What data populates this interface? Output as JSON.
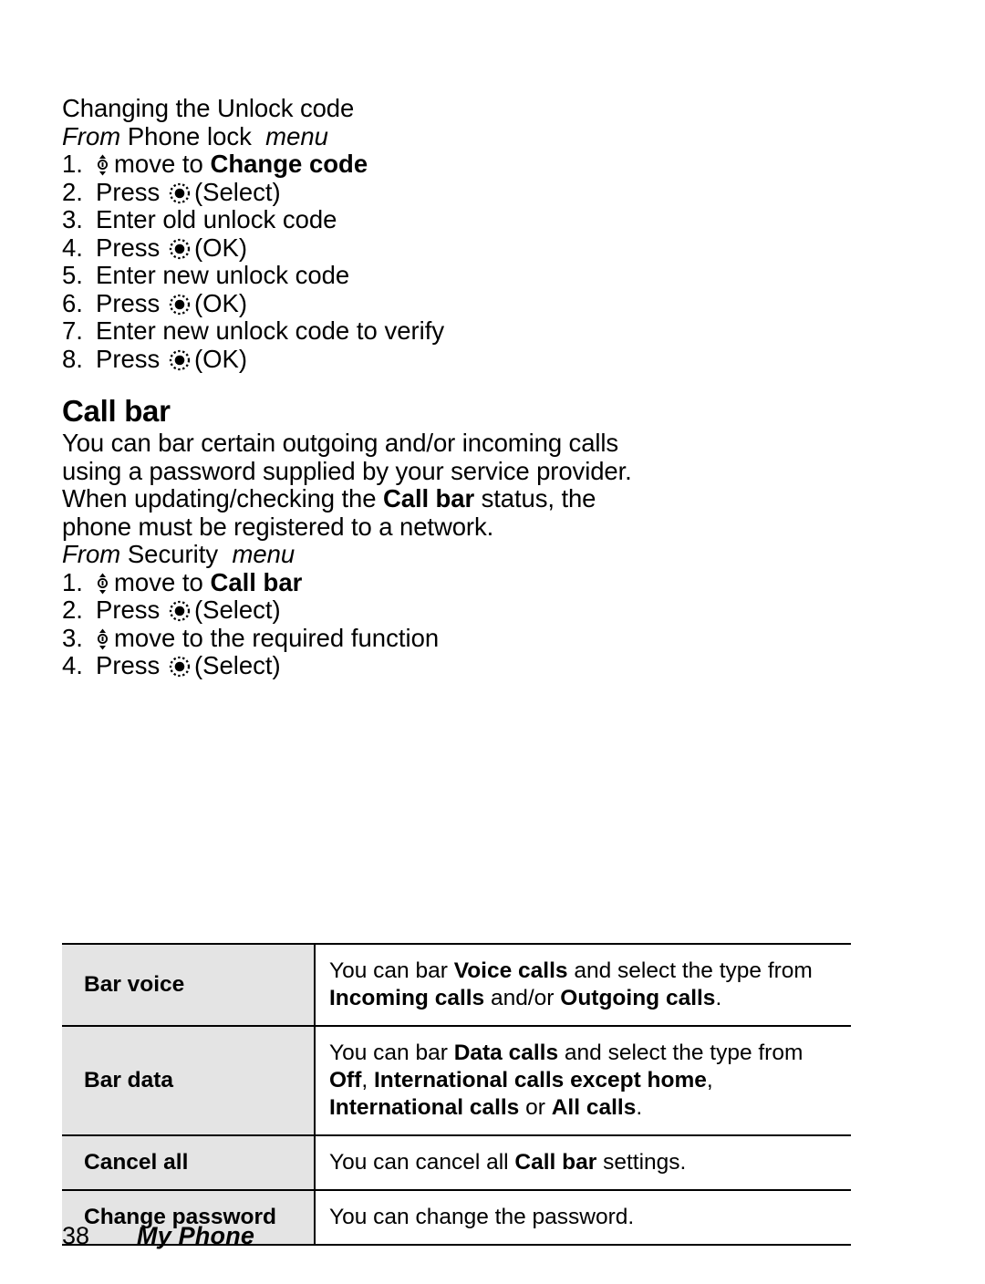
{
  "page": {
    "number": "38",
    "book_title": "My Phone"
  },
  "icons": {
    "nav_key": "navigation-key-up-down-icon",
    "select_key": "select-key-icon"
  },
  "sections": [
    {
      "id": "changing-unlock-code",
      "title": "Changing the Unlock code",
      "from_line": {
        "from": "From",
        "menu_name": "Phone lock",
        "menu": "menu"
      },
      "steps": [
        {
          "num": "1.",
          "icon": "nav_key",
          "text_before": "move to ",
          "bold": "Change code",
          "text_after": ""
        },
        {
          "num": "2.",
          "icon": "select_key",
          "text_before": "Press ",
          "bold": "",
          "text_after": "(Select)"
        },
        {
          "num": "3.",
          "icon": "",
          "text_before": "Enter old unlock code",
          "bold": "",
          "text_after": ""
        },
        {
          "num": "4.",
          "icon": "select_key",
          "text_before": "Press ",
          "bold": "",
          "text_after": "(OK)"
        },
        {
          "num": "5.",
          "icon": "",
          "text_before": "Enter new unlock code",
          "bold": "",
          "text_after": ""
        },
        {
          "num": "6.",
          "icon": "select_key",
          "text_before": "Press ",
          "bold": "",
          "text_after": "(OK)"
        },
        {
          "num": "7.",
          "icon": "",
          "text_before": "Enter new unlock code to verify",
          "bold": "",
          "text_after": ""
        },
        {
          "num": "8.",
          "icon": "select_key",
          "text_before": "Press ",
          "bold": "",
          "text_after": "(OK)"
        }
      ]
    },
    {
      "id": "call-bar",
      "heading": "Call bar",
      "body_lines": [
        "You can bar certain outgoing and/or incoming calls",
        "using a password supplied by your service provider."
      ],
      "body_line_3": {
        "pre": "When updating/checking the ",
        "bold": "Call bar",
        "post": " status, the"
      },
      "body_line_4": "phone must be registered to a network.",
      "from_line": {
        "from": "From",
        "menu_name": "Security",
        "menu": "menu"
      },
      "steps": [
        {
          "num": "1.",
          "icon": "nav_key",
          "text_before": "move to ",
          "bold": "Call bar",
          "text_after": ""
        },
        {
          "num": "2.",
          "icon": "select_key",
          "text_before": "Press ",
          "bold": "",
          "text_after": "(Select)"
        },
        {
          "num": "3.",
          "icon": "nav_key",
          "text_before": "move to the required function",
          "bold": "",
          "text_after": ""
        },
        {
          "num": "4.",
          "icon": "select_key",
          "text_before": "Press ",
          "bold": "",
          "text_after": "(Select)"
        }
      ]
    }
  ],
  "table": {
    "rows": [
      {
        "term": "Bar voice",
        "desc_lines": [
          [
            {
              "t": "You can bar ",
              "b": false
            },
            {
              "t": "Voice calls",
              "b": true
            },
            {
              "t": " and select the type from",
              "b": false
            }
          ],
          [
            {
              "t": "Incoming calls",
              "b": true
            },
            {
              "t": " and/or ",
              "b": false
            },
            {
              "t": "Outgoing calls",
              "b": true
            },
            {
              "t": ".",
              "b": false
            }
          ]
        ]
      },
      {
        "term": "Bar data",
        "desc_lines": [
          [
            {
              "t": "You can bar ",
              "b": false
            },
            {
              "t": "Data calls",
              "b": true
            },
            {
              "t": " and select the type from",
              "b": false
            }
          ],
          [
            {
              "t": "Off",
              "b": true
            },
            {
              "t": ", ",
              "b": false
            },
            {
              "t": "International calls except home",
              "b": true
            },
            {
              "t": ",",
              "b": false
            }
          ],
          [
            {
              "t": "International calls",
              "b": true
            },
            {
              "t": " or ",
              "b": false
            },
            {
              "t": "All calls",
              "b": true
            },
            {
              "t": ".",
              "b": false
            }
          ]
        ]
      },
      {
        "term": "Cancel all",
        "desc_lines": [
          [
            {
              "t": "You can cancel all ",
              "b": false
            },
            {
              "t": "Call bar",
              "b": true
            },
            {
              "t": " settings.",
              "b": false
            }
          ]
        ]
      },
      {
        "term": "Change password",
        "desc_lines": [
          [
            {
              "t": "You can change the password.",
              "b": false
            }
          ]
        ]
      }
    ]
  },
  "colors": {
    "term_cell_bg": "#e4e4e4",
    "rule": "#000000",
    "text": "#000000",
    "page_bg": "#ffffff"
  }
}
